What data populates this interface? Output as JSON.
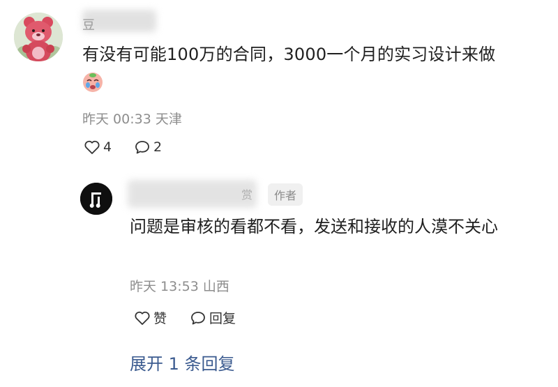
{
  "comment": {
    "name_hint": "豆",
    "text": "有没有可能100万的合同，3000一个月的实习设计来做",
    "emoji": "crying-face-emoji",
    "meta": "昨天 00:33 天津",
    "likes": "4",
    "replies": "2"
  },
  "reply": {
    "name_hint": "赏",
    "author_badge": "作者",
    "text": "问题是审核的看都不看，发送和接收的人漠不关心",
    "meta": "昨天 13:53 山西",
    "like_label": "赞",
    "reply_label": "回复"
  },
  "expand_label": "展开 1 条回复",
  "icons": {
    "like": "heart-outline-icon",
    "comment": "speech-bubble-icon",
    "reply_avatar_logo": "music-note-logo-icon"
  },
  "colors": {
    "meta_text": "#8d8d8d",
    "link": "#3a5a8f",
    "badge_bg": "#f0f0f0"
  }
}
